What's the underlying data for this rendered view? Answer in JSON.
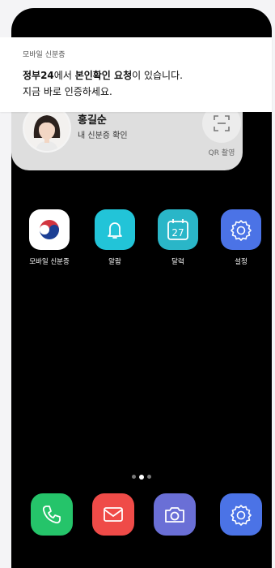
{
  "notification": {
    "app_name": "모바일 신분증",
    "line1_org": "정부24",
    "line1_mid": "에서 ",
    "line1_bold": "본인확인 요청",
    "line1_end": "이 있습니다.",
    "line2": "지금 바로 인증하세요."
  },
  "widget": {
    "name": "홍길순",
    "subtitle": "내 신분증 확인",
    "qr_label": "QR 촬영"
  },
  "apps": [
    {
      "label": "모바일 신분증",
      "icon": "government-emblem-icon",
      "color": "#ffffff"
    },
    {
      "label": "알람",
      "icon": "bell-icon",
      "color": "#22c4d8"
    },
    {
      "label": "달력",
      "icon": "calendar-icon",
      "color": "#2ab6c8",
      "day": "27"
    },
    {
      "label": "설정",
      "icon": "gear-icon",
      "color": "#4b73e6"
    }
  ],
  "page_indicator": {
    "count": 3,
    "active": 2
  },
  "dock": [
    {
      "icon": "phone-icon",
      "color": "#25c46a"
    },
    {
      "icon": "mail-icon",
      "color": "#ef4b48"
    },
    {
      "icon": "camera-icon",
      "color": "#6a6fd6"
    },
    {
      "icon": "gear-icon",
      "color": "#4b73e6"
    }
  ]
}
